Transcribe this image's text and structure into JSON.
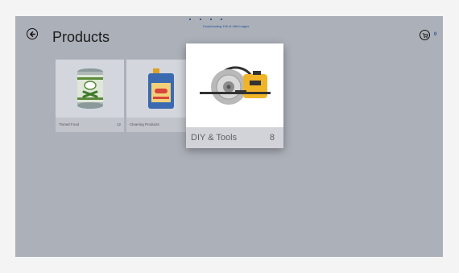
{
  "header": {
    "title": "Products",
    "download_status": "Downloading 190 of 456 Images",
    "cart_count": "0"
  },
  "icons": {
    "back": "back-arrow-icon",
    "cart": "cart-icon"
  },
  "categories": [
    {
      "name": "Tinned Food",
      "count": "12"
    },
    {
      "name": "Cleaning Products",
      "count": ""
    },
    {
      "name": "DIY & Tools",
      "count": "8"
    }
  ]
}
